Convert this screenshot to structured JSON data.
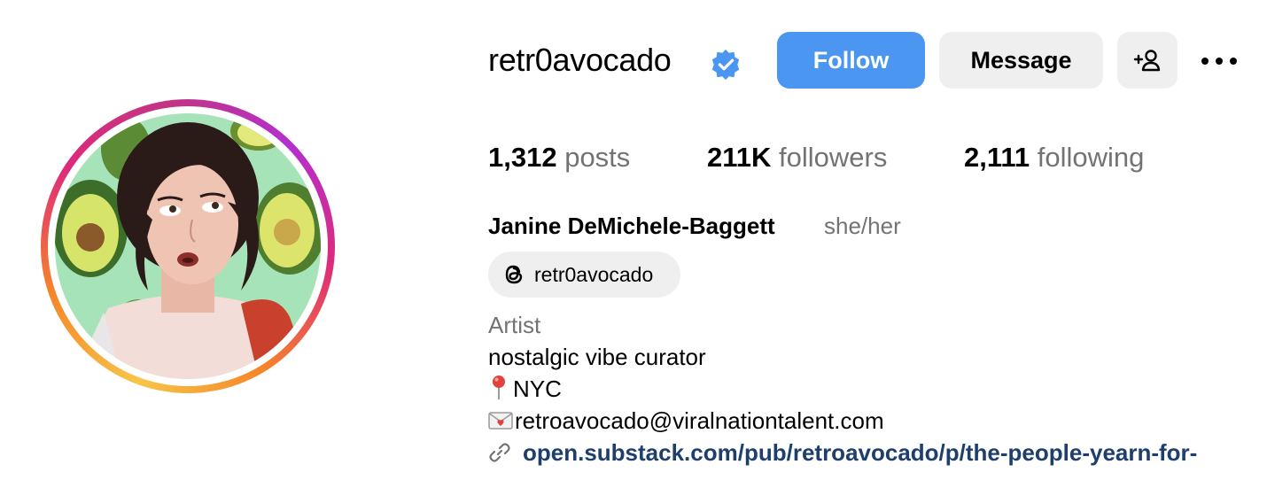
{
  "profile": {
    "username": "retr0avocado",
    "verified": true,
    "full_name": "Janine DeMichele-Baggett",
    "pronouns": "she/her"
  },
  "actions": {
    "follow_label": "Follow",
    "message_label": "Message",
    "add_user_icon": "add-user-icon",
    "more_icon": "more-options-icon"
  },
  "stats": [
    {
      "value": "1,312",
      "label": "posts"
    },
    {
      "value": "211K",
      "label": "followers"
    },
    {
      "value": "2,111",
      "label": "following"
    }
  ],
  "threads": {
    "handle": "retr0avocado",
    "icon": "threads-icon"
  },
  "bio": {
    "category": "Artist",
    "lines": [
      "nostalgic vibe curator",
      "NYC",
      "retroavocado@viralnationtalent.com"
    ],
    "line_icons": [
      "",
      "pin-emoji-icon",
      "envelope-emoji-icon"
    ],
    "link": "open.substack.com/pub/retroavocado/p/the-people-yearn-for-"
  },
  "colors": {
    "follow_button": "#4a96f0",
    "secondary_button": "#efefef",
    "muted_text": "#737373",
    "link_text": "#1e3f6d",
    "verified_badge": "#4a96f0"
  }
}
